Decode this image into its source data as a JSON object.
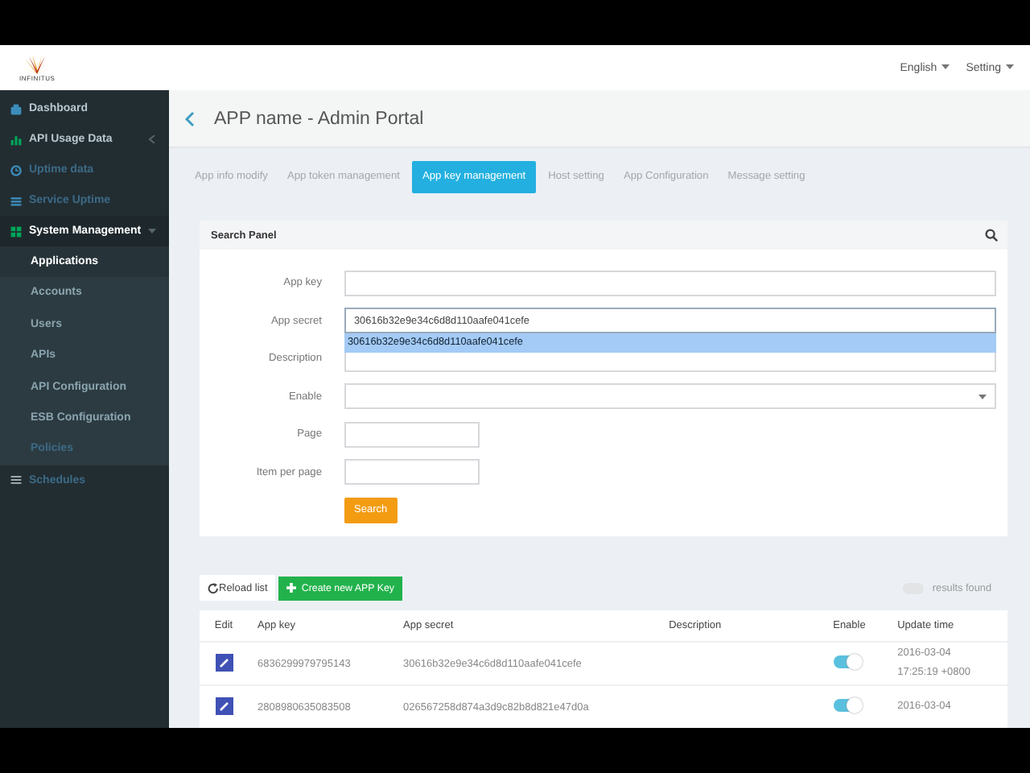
{
  "topbar": {
    "logo_text": "INFINITUS",
    "menus": [
      {
        "label": "English"
      },
      {
        "label": "Setting"
      }
    ]
  },
  "sidebar": {
    "items": [
      {
        "label": "Dashboard",
        "selected": false,
        "disabled": false
      },
      {
        "label": "API Usage Data",
        "selected": false,
        "disabled": false,
        "expanded": false
      },
      {
        "label": "Uptime data",
        "selected": false,
        "disabled": true
      },
      {
        "label": "Service Uptime",
        "selected": false,
        "disabled": true
      },
      {
        "label": "System Management",
        "selected": true,
        "disabled": false,
        "expanded": true,
        "children": [
          {
            "label": "Applications",
            "selected": true,
            "disabled": false
          },
          {
            "label": "Accounts",
            "selected": false,
            "disabled": false
          },
          {
            "label": "Users",
            "selected": false,
            "disabled": false
          },
          {
            "label": "APIs",
            "selected": false,
            "disabled": false
          },
          {
            "label": "API Configuration",
            "selected": false,
            "disabled": false
          },
          {
            "label": "ESB Configuration",
            "selected": false,
            "disabled": false
          },
          {
            "label": "Policies",
            "selected": false,
            "disabled": true
          }
        ]
      },
      {
        "label": "Schedules",
        "selected": false,
        "disabled": true
      }
    ]
  },
  "header": {
    "title": "APP name - Admin Portal"
  },
  "tabs": [
    {
      "label": "App info modify",
      "selected": false
    },
    {
      "label": "App token management",
      "selected": false
    },
    {
      "label": "App key management",
      "selected": true
    },
    {
      "label": "Host setting",
      "selected": false
    },
    {
      "label": "App Configuration",
      "selected": false
    },
    {
      "label": "Message setting",
      "selected": false
    }
  ],
  "search_panel": {
    "title": "Search Panel",
    "fields": [
      {
        "label": "App key",
        "kind": "text"
      },
      {
        "label": "App secret",
        "kind": "text",
        "value": "30616b32e9e34c6d8d110aafe041cefe",
        "suggestion": "30616b32e9e34c6d8d110aafe041cefe"
      },
      {
        "label": "Description",
        "kind": "text"
      },
      {
        "label": "Enable",
        "kind": "select"
      },
      {
        "label": "Page",
        "kind": "short"
      },
      {
        "label": "Item per page",
        "kind": "short"
      }
    ],
    "button": "Search"
  },
  "list": {
    "reload_button": "Reload list",
    "create_button": "Create new APP Key",
    "results_label": "results found",
    "columns": [
      "Edit",
      "App key",
      "App secret",
      "Description",
      "Enable",
      "Update time"
    ],
    "rows": [
      {
        "app_key": "6836299979795143",
        "app_secret": "30616b32e9e34c6d8d110aafe041cefe",
        "description": "",
        "enabled": true,
        "update_time": [
          "2016-03-04",
          "17:25:19 +0800"
        ]
      },
      {
        "app_key": "2808980635083508",
        "app_secret": "026567258d874a3d9c82b8d821e47d0a",
        "description": "",
        "enabled": true,
        "update_time": [
          "2016-03-04"
        ]
      }
    ]
  }
}
